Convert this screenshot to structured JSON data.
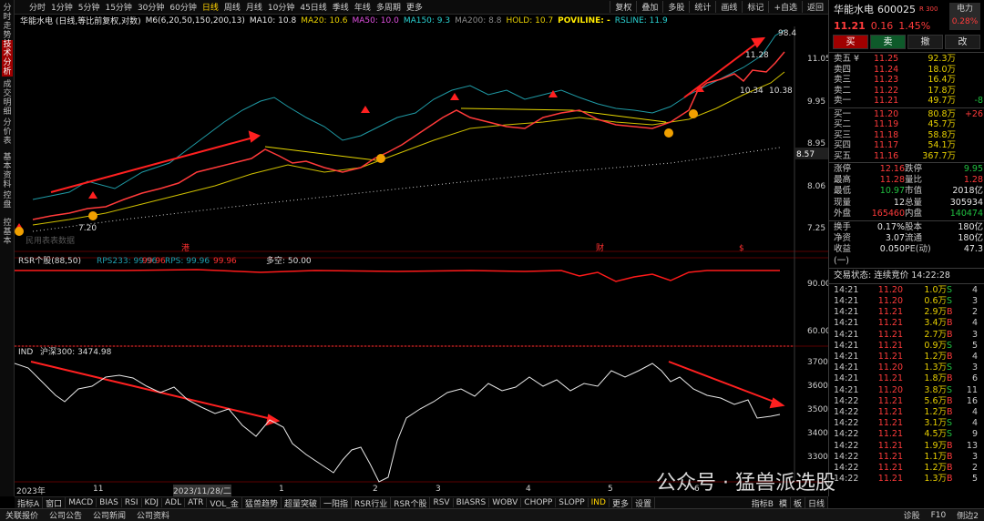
{
  "left_tabs": [
    "分时走势",
    "技术分析",
    "成交明细",
    "分价表",
    "基本资料",
    "控盘",
    "控基本"
  ],
  "left_tab_active": 1,
  "periods": [
    "分时",
    "1分钟",
    "5分钟",
    "15分钟",
    "30分钟",
    "60分钟",
    "日线",
    "周线",
    "月线",
    "10分钟",
    "45日线",
    "季线",
    "年线",
    "多周期",
    "更多"
  ],
  "period_active": "日线",
  "tools": [
    "复权",
    "叠加",
    "多股",
    "统计",
    "画线",
    "标记",
    "+自选",
    "返回"
  ],
  "ma_legend": {
    "stock": "华能水电 (日线,等比前复权,对数)",
    "m6": "M6(6,20,50,150,200,13)",
    "ma10": "MA10: 10.8",
    "ma20": "MA20: 10.6",
    "ma50": "MA50: 10.0",
    "ma150": "MA150: 9.3",
    "ma200": "MA200: 8.8",
    "hold": "HOLD: 10.7",
    "poviline": "POVILINE: -",
    "rsline": "RSLINE: 11.9"
  },
  "main_axis": [
    "11.05",
    "9.95",
    "8.95",
    "8.06",
    "7.25"
  ],
  "main_axis_tag": "8.57",
  "main_annotations": {
    "high": "11.28",
    "high_extra": "98.4",
    "low_a": "10.34",
    "low_b": "10.38",
    "first_low": "7.20",
    "watermark_text": "民用表表数据"
  },
  "rsr_legend": {
    "title": "RSR个股(88,50)",
    "rps233": "RPS233: 99.96",
    "v2": "99.96",
    "rps": "RPS: 99.96",
    "v3": "99.96",
    "multi": "多空: 50.00"
  },
  "rsr_axis": [
    "90.00",
    "60.00"
  ],
  "ind_legend": {
    "title": "IND",
    "hs300": "沪深300: 3474.98"
  },
  "ind_axis": [
    "3700",
    "3600",
    "3500",
    "3400",
    "3300"
  ],
  "x_axis": [
    "2023年",
    "11",
    "2023/11/28/二",
    "1",
    "2",
    "3",
    "4",
    "5",
    "6"
  ],
  "event_tags": [
    "港",
    "财",
    "$"
  ],
  "right": {
    "name": "华能水电",
    "code": "600025",
    "r300": "R 300",
    "sector": "电力",
    "sector_pct": "0.28%",
    "price": "11.21",
    "change": "0.16",
    "change_pct": "1.45%",
    "buttons": [
      "买",
      "卖",
      "撤",
      "改"
    ],
    "asks": [
      {
        "label": "卖五 ¥",
        "price": "11.25",
        "vol": "92.3万",
        "chg": ""
      },
      {
        "label": "卖四",
        "price": "11.24",
        "vol": "18.0万",
        "chg": ""
      },
      {
        "label": "卖三",
        "price": "11.23",
        "vol": "16.4万",
        "chg": ""
      },
      {
        "label": "卖二",
        "price": "11.22",
        "vol": "17.8万",
        "chg": ""
      },
      {
        "label": "卖一",
        "price": "11.21",
        "vol": "49.7万",
        "chg": "-8"
      }
    ],
    "bids": [
      {
        "label": "买一",
        "price": "11.20",
        "vol": "80.8万",
        "chg": "+26"
      },
      {
        "label": "买二",
        "price": "11.19",
        "vol": "45.7万",
        "chg": ""
      },
      {
        "label": "买三",
        "price": "11.18",
        "vol": "58.8万",
        "chg": ""
      },
      {
        "label": "买四",
        "price": "11.17",
        "vol": "54.1万",
        "chg": ""
      },
      {
        "label": "买五",
        "price": "11.16",
        "vol": "367.7万",
        "chg": ""
      }
    ],
    "stats": [
      [
        "涨停",
        "12.16",
        "跌停",
        "9.95"
      ],
      [
        "最高",
        "11.28",
        "量比",
        "1.28"
      ],
      [
        "最低",
        "10.97",
        "市值",
        "2018亿"
      ],
      [
        "现量",
        "12",
        "总量",
        "305934"
      ],
      [
        "外盘",
        "165460",
        "内盘",
        "140474"
      ]
    ],
    "stats2": [
      [
        "换手",
        "0.17%",
        "股本",
        "180亿"
      ],
      [
        "净资",
        "3.07",
        "流通",
        "180亿"
      ],
      [
        "收益(一)",
        "0.050",
        "PE(动)",
        "47.3"
      ]
    ],
    "status_label": "交易状态: 连续竞价 14:22:28",
    "ticks": [
      [
        "14:21",
        "11.20",
        "1.0万",
        "S",
        "4"
      ],
      [
        "14:21",
        "11.20",
        "0.6万",
        "S",
        "3"
      ],
      [
        "14:21",
        "11.21",
        "2.9万",
        "B",
        "2"
      ],
      [
        "14:21",
        "11.21",
        "3.4万",
        "B",
        "4"
      ],
      [
        "14:21",
        "11.21",
        "2.7万",
        "B",
        "3"
      ],
      [
        "14:21",
        "11.21",
        "0.9万",
        "S",
        "5"
      ],
      [
        "14:21",
        "11.21",
        "1.2万",
        "B",
        "4"
      ],
      [
        "14:21",
        "11.20",
        "1.3万",
        "S",
        "3"
      ],
      [
        "14:21",
        "11.21",
        "1.8万",
        "B",
        "6"
      ],
      [
        "14:21",
        "11.20",
        "3.8万",
        "S",
        "11"
      ],
      [
        "14:22",
        "11.21",
        "5.6万",
        "B",
        "16"
      ],
      [
        "14:22",
        "11.21",
        "1.2万",
        "B",
        "4"
      ],
      [
        "14:22",
        "11.21",
        "3.1万",
        "S",
        "4"
      ],
      [
        "14:22",
        "11.21",
        "4.5万",
        "S",
        "9"
      ],
      [
        "14:22",
        "11.21",
        "1.9万",
        "B",
        "13"
      ],
      [
        "14:22",
        "11.21",
        "1.1万",
        "B",
        "3"
      ],
      [
        "14:22",
        "11.21",
        "1.2万",
        "B",
        "2"
      ],
      [
        "14:22",
        "11.21",
        "1.3万",
        "B",
        "5"
      ]
    ]
  },
  "indicator_tabs": [
    "指标A",
    "窗口",
    "MACD",
    "BIAS",
    "RSI",
    "KDJ",
    "ADL",
    "ATR",
    "VOL_金",
    "猛兽趋势",
    "超量突破",
    "一阳指",
    "RSR行业",
    "RSR个股",
    "RSV",
    "BIASRS",
    "WOBV",
    "CHOPP",
    "SLOPP",
    "IND",
    "更多",
    "设置"
  ],
  "indicator_active": "IND",
  "indicator_right": [
    "指标B",
    "模",
    "板",
    "日线"
  ],
  "status_bar": [
    "关联报价",
    "公司公告",
    "公司新闻",
    "公司资料"
  ],
  "status_right": [
    "诊股",
    "F10",
    "侧边2"
  ],
  "watermark": "公众号 · 猛兽派选股"
}
